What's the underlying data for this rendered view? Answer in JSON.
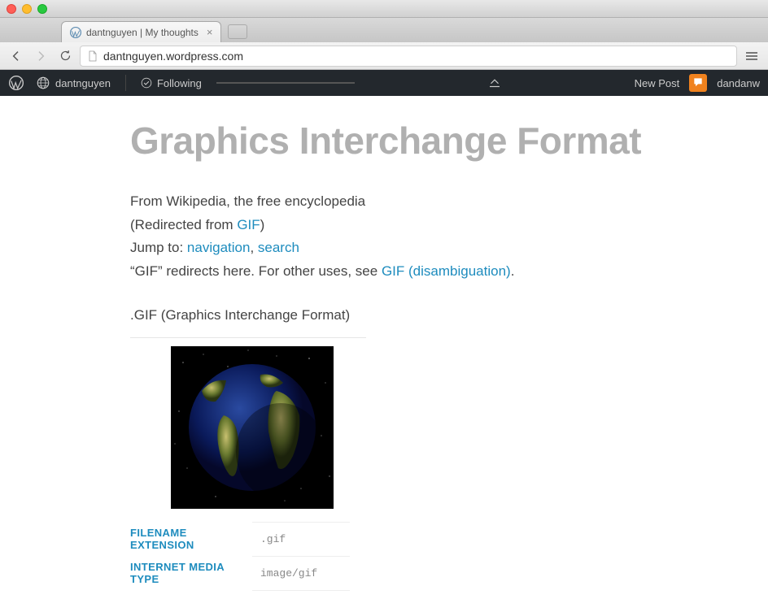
{
  "chrome": {
    "tab_title": "dantnguyen | My thoughts",
    "url": "dantnguyen.wordpress.com"
  },
  "wpbar": {
    "site_name": "dantnguyen",
    "following_label": "Following",
    "new_post_label": "New Post",
    "username": "dandanw"
  },
  "article": {
    "title": "Graphics Interchange Format",
    "from_line_prefix": "From Wikipedia, the free encyclopedia",
    "redirected_prefix": "(Redirected from ",
    "redirected_link": "GIF",
    "redirected_suffix": ")",
    "jump_prefix": "Jump to: ",
    "jump_nav": "navigation",
    "jump_sep": ", ",
    "jump_search": "search",
    "redirects_prefix": "“GIF” redirects here. For other uses, see ",
    "redirects_link": "GIF (disambiguation)",
    "redirects_suffix": ".",
    "subheading": ".GIF (Graphics Interchange Format)",
    "infotable": {
      "row1_label": "FILENAME EXTENSION",
      "row1_value": ".gif",
      "row2_label": "INTERNET MEDIA TYPE",
      "row2_value": "image/gif"
    }
  }
}
